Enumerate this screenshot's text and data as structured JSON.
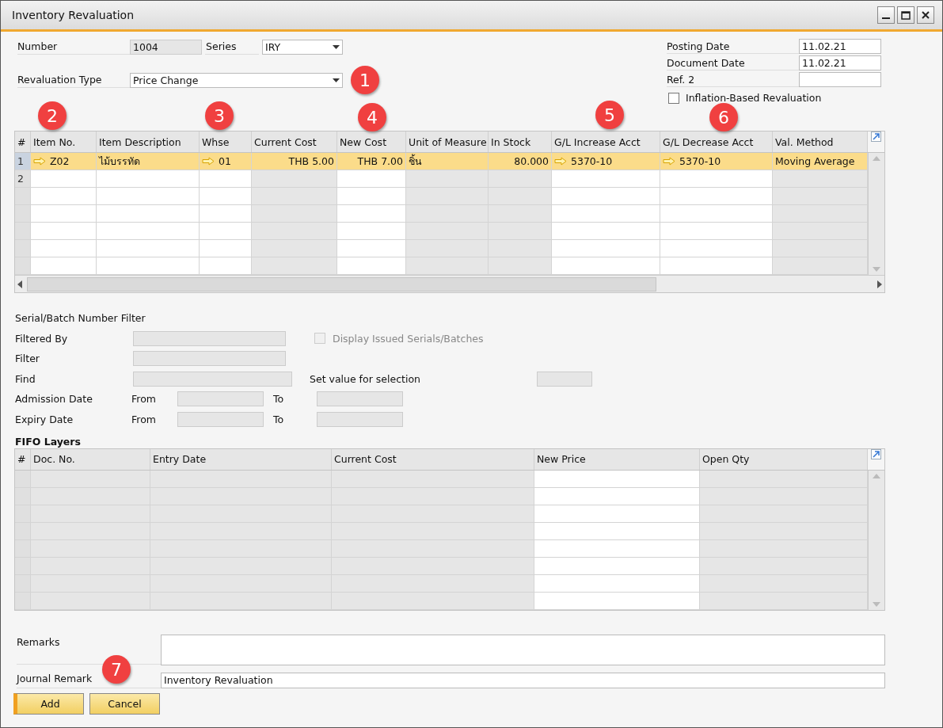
{
  "window": {
    "title": "Inventory Revaluation"
  },
  "header": {
    "number_label": "Number",
    "number": "1004",
    "series_label": "Series",
    "series": "IRY",
    "type_label": "Revaluation Type",
    "type": "Price Change",
    "dates": [
      {
        "label": "Posting Date",
        "value": "11.02.21"
      },
      {
        "label": "Document Date",
        "value": "11.02.21"
      },
      {
        "label": "Ref. 2"
      }
    ],
    "inflation_checkbox": {
      "label": "Inflation-Based Revaluation",
      "checked": false
    }
  },
  "grid": {
    "columns": [
      {
        "label": "#"
      },
      {
        "label": "Item No.",
        "editable": true,
        "link": true,
        "kind": "text"
      },
      {
        "label": "Item Description",
        "editable": true,
        "link": false,
        "kind": "text"
      },
      {
        "label": "Whse",
        "editable": true,
        "link": true,
        "kind": "text"
      },
      {
        "label": "Current Cost",
        "editable": false,
        "link": false,
        "kind": "number"
      },
      {
        "label": "New Cost",
        "editable": true,
        "link": false,
        "kind": "number"
      },
      {
        "label": "Unit of Measure",
        "editable": false,
        "link": false,
        "kind": "text"
      },
      {
        "label": "In Stock",
        "editable": false,
        "link": false,
        "kind": "number"
      },
      {
        "label": "G/L Increase Acct",
        "editable": true,
        "link": true,
        "kind": "text"
      },
      {
        "label": "G/L Decrease Acct",
        "editable": true,
        "link": true,
        "kind": "text"
      },
      {
        "label": "Val. Method",
        "editable": false,
        "link": false,
        "kind": "text"
      }
    ],
    "rows": [
      {
        "number": "1",
        "selected": true,
        "cells": [
          "Z02",
          "ไม้บรรทัด",
          "01",
          "THB 5.00",
          "THB 7.00",
          "ชิ้น",
          "80.000",
          "5370-10",
          "5370-10",
          "Moving Average"
        ]
      },
      {
        "number": "2",
        "selected": false
      }
    ]
  },
  "serial_filter": {
    "title": "Serial/Batch Number Filter",
    "filtered_by": "Filtered By",
    "filter": "Filter",
    "find": "Find",
    "display_issued": {
      "label": "Display Issued Serials/Batches",
      "checked": false,
      "disabled": true
    },
    "set_value": "Set value for selection",
    "date_ranges": [
      {
        "label": "Admission Date",
        "from": "From",
        "to": "To"
      },
      {
        "label": "Expiry Date",
        "from": "From",
        "to": "To"
      }
    ]
  },
  "fifo": {
    "title": "FIFO Layers",
    "columns": [
      {
        "label": "#"
      },
      {
        "label": "Doc. No.",
        "editable": false
      },
      {
        "label": "Entry Date",
        "editable": false
      },
      {
        "label": "Current Cost",
        "editable": false
      },
      {
        "label": "New Price",
        "editable": true
      },
      {
        "label": "Open Qty",
        "editable": false
      }
    ]
  },
  "remarks_label": "Remarks",
  "journal_label": "Journal Remark",
  "journal": "Inventory Revaluation",
  "buttons": [
    {
      "label": "Add",
      "focused": true
    },
    {
      "label": "Cancel",
      "focused": false
    }
  ],
  "callouts": [
    "1",
    "2",
    "3",
    "4",
    "5",
    "6",
    "7"
  ]
}
